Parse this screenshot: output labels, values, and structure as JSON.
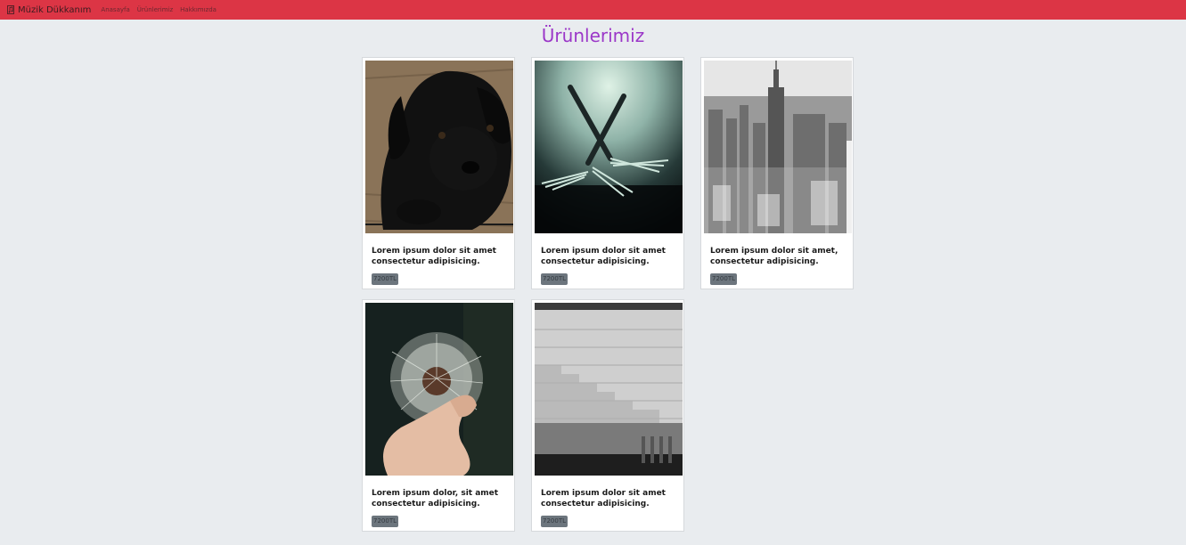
{
  "navbar": {
    "brand": "Müzik Dükkanım",
    "brand_icon": "music-note-icon",
    "links": [
      "Anasayfa",
      "Ürünlerimiz",
      "Hakkımızda"
    ],
    "background": "#dc3545"
  },
  "main": {
    "title": "Ürünlerimiz",
    "title_color": "#9b37c8"
  },
  "products": [
    {
      "image": "black-puppy-photo",
      "description": "Lorem ipsum dolor sit amet consectetur adipisicing.",
      "price": "7200TL"
    },
    {
      "image": "forks-photo",
      "description": "Lorem ipsum dolor sit amet consectetur adipisicing.",
      "price": "7200TL"
    },
    {
      "image": "city-skyline-photo",
      "description": "Lorem ipsum dolor sit amet, consectetur adipisicing.",
      "price": "7200TL"
    },
    {
      "image": "dandelion-photo",
      "description": "Lorem ipsum dolor, sit amet consectetur adipisicing.",
      "price": "7200TL"
    },
    {
      "image": "stone-stairs-photo",
      "description": "Lorem ipsum dolor sit amet consectetur adipisicing.",
      "price": "7200TL"
    }
  ]
}
